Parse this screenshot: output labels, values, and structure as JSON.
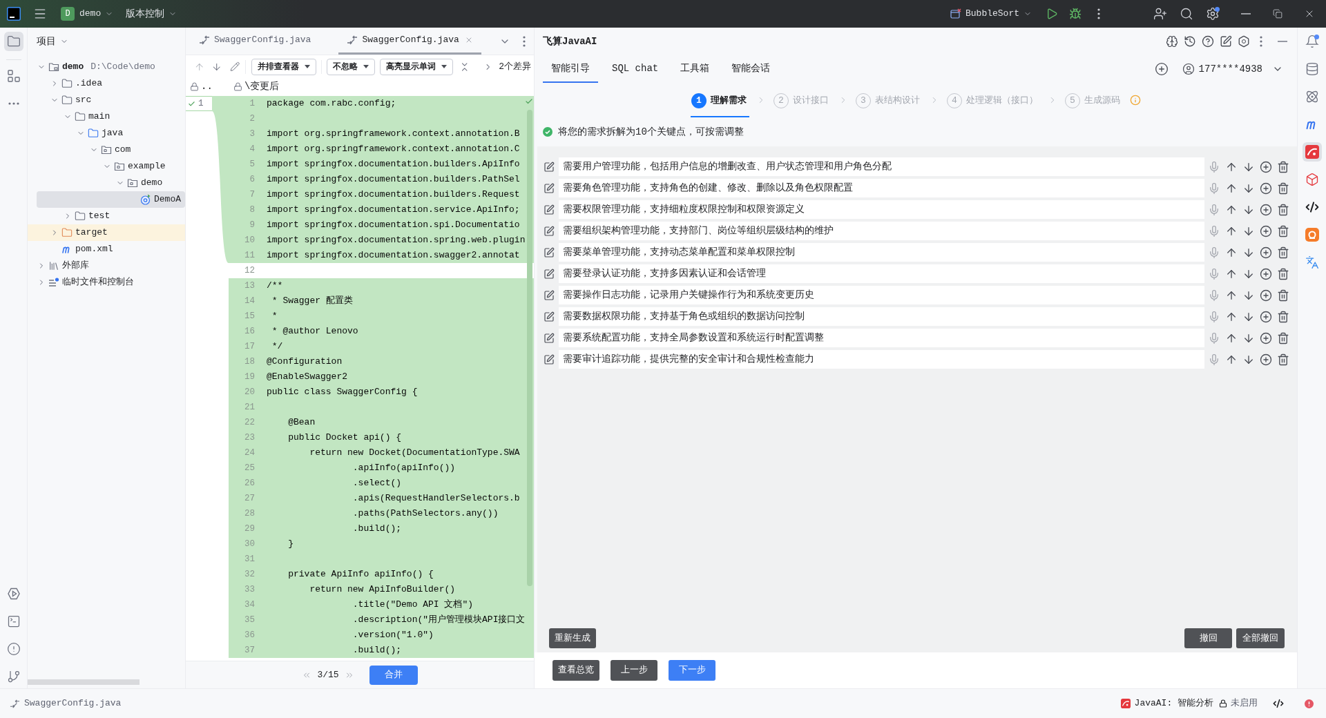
{
  "title_bar": {
    "project_badge": "D",
    "project": "demo",
    "vcs_menu": "版本控制",
    "run_config": "BubbleSort"
  },
  "left_toolbar": [
    {
      "selected": true
    },
    {
      "selected": false
    },
    {
      "selected": false
    }
  ],
  "project_panel": {
    "title": "项目",
    "tree": [
      {
        "label": "demo",
        "path": "D:\\Code\\demo",
        "kind": "module",
        "expanded": true,
        "selected": false,
        "children": [
          {
            "label": ".idea",
            "kind": "folder",
            "expanded": false,
            "selected": false
          },
          {
            "label": "src",
            "kind": "folder",
            "expanded": true,
            "selected": false,
            "children": [
              {
                "label": "main",
                "kind": "folder",
                "expanded": true,
                "selected": false,
                "children": [
                  {
                    "label": "java",
                    "kind": "source",
                    "expanded": true,
                    "selected": false,
                    "children": [
                      {
                        "label": "com",
                        "kind": "package",
                        "expanded": true,
                        "selected": false,
                        "children": [
                          {
                            "label": "example",
                            "kind": "package",
                            "expanded": true,
                            "selected": false,
                            "children": [
                              {
                                "label": "demo",
                                "kind": "package",
                                "expanded": true,
                                "selected": false,
                                "children": [
                                  {
                                    "label": "DemoA",
                                    "kind": "class",
                                    "selected": true
                                  }
                                ]
                              }
                            ]
                          }
                        ]
                      }
                    ]
                  }
                ]
              },
              {
                "label": "test",
                "kind": "folder",
                "expanded": false,
                "selected": false
              }
            ]
          },
          {
            "label": "target",
            "kind": "excluded",
            "expanded": false,
            "selected": false
          },
          {
            "label": "pom.xml",
            "kind": "maven",
            "selected": false
          }
        ]
      },
      {
        "label": "外部库",
        "kind": "library",
        "expanded": false,
        "selected": false
      },
      {
        "label": "临时文件和控制台",
        "kind": "scratch",
        "expanded": false,
        "selected": false
      }
    ]
  },
  "editor": {
    "tabs": [
      {
        "label": "SwaggerConfig.java",
        "selected": false
      },
      {
        "label": "SwaggerConfig.java",
        "selected": true
      }
    ],
    "toolbar": {
      "dropdowns": [
        "并排查看器",
        "不忽略",
        "高亮显示单词"
      ],
      "diff_count": "2个差异"
    },
    "left_title": "..",
    "right_title": "\\变更后",
    "left_lines": [
      {
        "number": "1"
      }
    ],
    "lines": [
      {
        "number": "1",
        "code": "package com.rabc.config;",
        "changed": true
      },
      {
        "number": "2",
        "changed": true
      },
      {
        "number": "3",
        "code": "import org.springframework.context.annotation.B",
        "changed": true
      },
      {
        "number": "4",
        "code": "import org.springframework.context.annotation.C",
        "changed": true
      },
      {
        "number": "5",
        "code": "import springfox.documentation.builders.ApiInfo",
        "changed": true
      },
      {
        "number": "6",
        "code": "import springfox.documentation.builders.PathSel",
        "changed": true
      },
      {
        "number": "7",
        "code": "import springfox.documentation.builders.Request",
        "changed": true
      },
      {
        "number": "8",
        "code": "import springfox.documentation.service.ApiInfo;",
        "changed": true
      },
      {
        "number": "9",
        "code": "import springfox.documentation.spi.Documentatio",
        "changed": true
      },
      {
        "number": "10",
        "code": "import springfox.documentation.spring.web.plugin",
        "changed": true
      },
      {
        "number": "11",
        "code": "import springfox.documentation.swagger2.annotat",
        "changed": true
      },
      {
        "number": "12",
        "changed": false
      },
      {
        "number": "13",
        "code": "/**",
        "changed": true
      },
      {
        "number": "14",
        "code": " * Swagger 配置类",
        "changed": true
      },
      {
        "number": "15",
        "code": " *",
        "changed": true
      },
      {
        "number": "16",
        "code": " * @author Lenovo",
        "changed": true
      },
      {
        "number": "17",
        "code": " */",
        "changed": true
      },
      {
        "number": "18",
        "code": "@Configuration",
        "changed": true
      },
      {
        "number": "19",
        "code": "@EnableSwagger2",
        "changed": true
      },
      {
        "number": "20",
        "code": "public class SwaggerConfig {",
        "changed": true
      },
      {
        "number": "21",
        "changed": true
      },
      {
        "number": "22",
        "code": "    @Bean",
        "changed": true
      },
      {
        "number": "23",
        "code": "    public Docket api() {",
        "changed": true
      },
      {
        "number": "24",
        "code": "        return new Docket(DocumentationType.SWA",
        "changed": true
      },
      {
        "number": "25",
        "code": "                .apiInfo(apiInfo())",
        "changed": true
      },
      {
        "number": "26",
        "code": "                .select()",
        "changed": true
      },
      {
        "number": "27",
        "code": "                .apis(RequestHandlerSelectors.b",
        "changed": true
      },
      {
        "number": "28",
        "code": "                .paths(PathSelectors.any())",
        "changed": true
      },
      {
        "number": "29",
        "code": "                .build();",
        "changed": true
      },
      {
        "number": "30",
        "code": "    }",
        "changed": true
      },
      {
        "number": "31",
        "changed": true
      },
      {
        "number": "32",
        "code": "    private ApiInfo apiInfo() {",
        "changed": true
      },
      {
        "number": "33",
        "code": "        return new ApiInfoBuilder()",
        "changed": true
      },
      {
        "number": "34",
        "code": "                .title(\"Demo API 文档\")",
        "changed": true
      },
      {
        "number": "35",
        "code": "                .description(\"用户管理模块API接口文",
        "changed": true
      },
      {
        "number": "36",
        "code": "                .version(\"1.0\")",
        "changed": true
      },
      {
        "number": "37",
        "code": "                .build();",
        "changed": true
      }
    ],
    "pager": "3/15",
    "merge_button": "合并"
  },
  "ai_panel": {
    "title": "飞算JavaAI",
    "tabs": [
      {
        "label": "智能引导",
        "selected": true
      },
      {
        "label": "SQL chat",
        "selected": false
      },
      {
        "label": "工具箱",
        "selected": false
      },
      {
        "label": "智能会话",
        "selected": false
      }
    ],
    "account": "177****4938",
    "steps": [
      {
        "number": "1",
        "label": "理解需求",
        "selected": true
      },
      {
        "number": "2",
        "label": "设计接口",
        "selected": false
      },
      {
        "number": "3",
        "label": "表结构设计",
        "selected": false
      },
      {
        "number": "4",
        "label": "处理逻辑（接口）",
        "selected": false
      },
      {
        "number": "5",
        "label": "生成源码",
        "selected": false
      }
    ],
    "notice": "将您的需求拆解为10个关键点，可按需调整",
    "requirements": [
      "需要用户管理功能，包括用户信息的增删改查、用户状态管理和用户角色分配",
      "需要角色管理功能，支持角色的创建、修改、删除以及角色权限配置",
      "需要权限管理功能，支持细粒度权限控制和权限资源定义",
      "需要组织架构管理功能，支持部门、岗位等组织层级结构的维护",
      "需要菜单管理功能，支持动态菜单配置和菜单权限控制",
      "需要登录认证功能，支持多因素认证和会话管理",
      "需要操作日志功能，记录用户关键操作行为和系统变更历史",
      "需要数据权限功能，支持基于角色或组织的数据访问控制",
      "需要系统配置功能，支持全局参数设置和系统运行时配置调整",
      "需要审计追踪功能，提供完整的安全审计和合规性检查能力"
    ],
    "regenerate_button": "重新生成",
    "undo_button": "撤回",
    "undo_all_button": "全部撤回",
    "footer_buttons": [
      {
        "label": "查看总览",
        "kind": "secondary"
      },
      {
        "label": "上一步",
        "kind": "secondary"
      },
      {
        "label": "下一步",
        "kind": "primary"
      }
    ]
  },
  "right_toolbar": [
    {
      "selected": false
    },
    {
      "selected": false
    },
    {
      "selected": false
    },
    {
      "selected": false
    },
    {
      "selected": true
    },
    {
      "selected": false
    },
    {
      "selected": false
    },
    {
      "selected": false
    },
    {
      "selected": false
    }
  ],
  "status_bar": {
    "file": "SwaggerConfig.java",
    "plugin_status": "JavaAI: 智能分析",
    "lock_status": "未启用"
  }
}
